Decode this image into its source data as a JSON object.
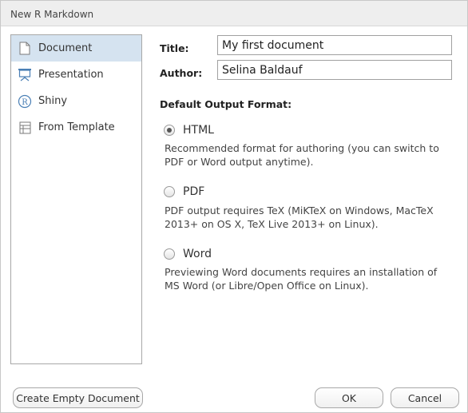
{
  "window": {
    "title": "New R Markdown"
  },
  "sidebar": {
    "items": [
      {
        "label": "Document",
        "icon": "document-icon",
        "selected": true
      },
      {
        "label": "Presentation",
        "icon": "presentation-icon",
        "selected": false
      },
      {
        "label": "Shiny",
        "icon": "shiny-r-icon",
        "selected": false,
        "icon_text": "R"
      },
      {
        "label": "From Template",
        "icon": "template-icon",
        "selected": false
      }
    ]
  },
  "form": {
    "title_label": "Title:",
    "title_value": "My first document",
    "author_label": "Author:",
    "author_value": "Selina Baldauf"
  },
  "output": {
    "section_title": "Default Output Format:",
    "options": [
      {
        "label": "HTML",
        "checked": true,
        "description": "Recommended format for authoring (you can switch to PDF or Word output anytime)."
      },
      {
        "label": "PDF",
        "checked": false,
        "description": "PDF output requires TeX (MiKTeX on Windows, MacTeX 2013+ on OS X, TeX Live 2013+ on Linux)."
      },
      {
        "label": "Word",
        "checked": false,
        "description": "Previewing Word documents requires an installation of MS Word (or Libre/Open Office on Linux)."
      }
    ]
  },
  "buttons": {
    "create_empty": "Create Empty Document",
    "ok": "OK",
    "cancel": "Cancel"
  },
  "colors": {
    "selected_bg": "#d5e3f0",
    "icon_blue": "#4a7fb5"
  }
}
